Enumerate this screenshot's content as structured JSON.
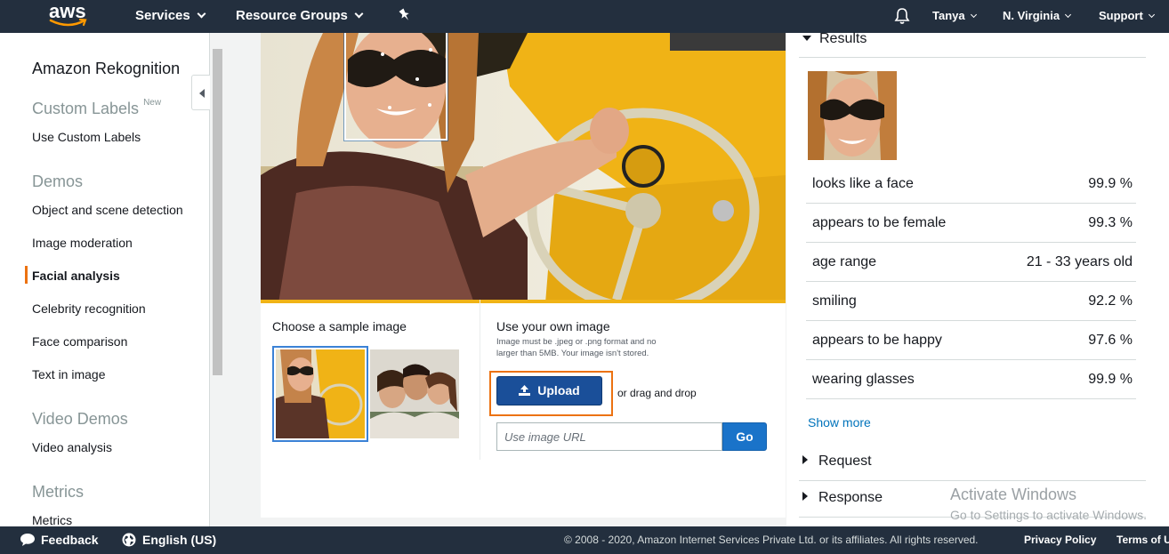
{
  "topnav": {
    "logo_text": "aws",
    "services": "Services",
    "resource_groups": "Resource Groups",
    "user": "Tanya",
    "region": "N. Virginia",
    "support": "Support"
  },
  "sidebar": {
    "title": "Amazon Rekognition",
    "custom_labels_head": "Custom Labels",
    "custom_labels_badge": "New",
    "use_custom_labels": "Use Custom Labels",
    "demos_head": "Demos",
    "demo_items": [
      "Object and scene detection",
      "Image moderation",
      "Facial analysis",
      "Celebrity recognition",
      "Face comparison",
      "Text in image"
    ],
    "video_demos_head": "Video Demos",
    "video_analysis": "Video analysis",
    "metrics_head": "Metrics",
    "metrics_item": "Metrics"
  },
  "main": {
    "choose_sample": "Choose a sample image",
    "use_own": "Use your own image",
    "hint": "Image must be .jpeg or .png format and no larger than 5MB. Your image isn't stored.",
    "upload_label": "Upload",
    "drag_drop": "or drag and drop",
    "url_placeholder": "Use image URL",
    "go_label": "Go"
  },
  "results": {
    "results_head": "Results",
    "rows": [
      {
        "label": "looks like a face",
        "value": "99.9 %"
      },
      {
        "label": "appears to be female",
        "value": "99.3 %"
      },
      {
        "label": "age range",
        "value": "21 - 33 years old"
      },
      {
        "label": "smiling",
        "value": "92.2 %"
      },
      {
        "label": "appears to be happy",
        "value": "97.6 %"
      },
      {
        "label": "wearing glasses",
        "value": "99.9 %"
      }
    ],
    "show_more": "Show more",
    "request_head": "Request",
    "response_head": "Response"
  },
  "watermark": {
    "line1": "Activate Windows",
    "line2": "Go to Settings to activate Windows."
  },
  "footer": {
    "feedback": "Feedback",
    "language": "English (US)",
    "copyright": "© 2008 - 2020, Amazon Internet Services Private Ltd. or its affiliates. All rights reserved.",
    "privacy": "Privacy Policy",
    "terms": "Terms of U"
  },
  "colors": {
    "nav_bg": "#232f3e",
    "accent_orange": "#ec7211",
    "upload_blue": "#1a4f99",
    "go_blue": "#1a73c9",
    "link_blue": "#0073bb"
  }
}
